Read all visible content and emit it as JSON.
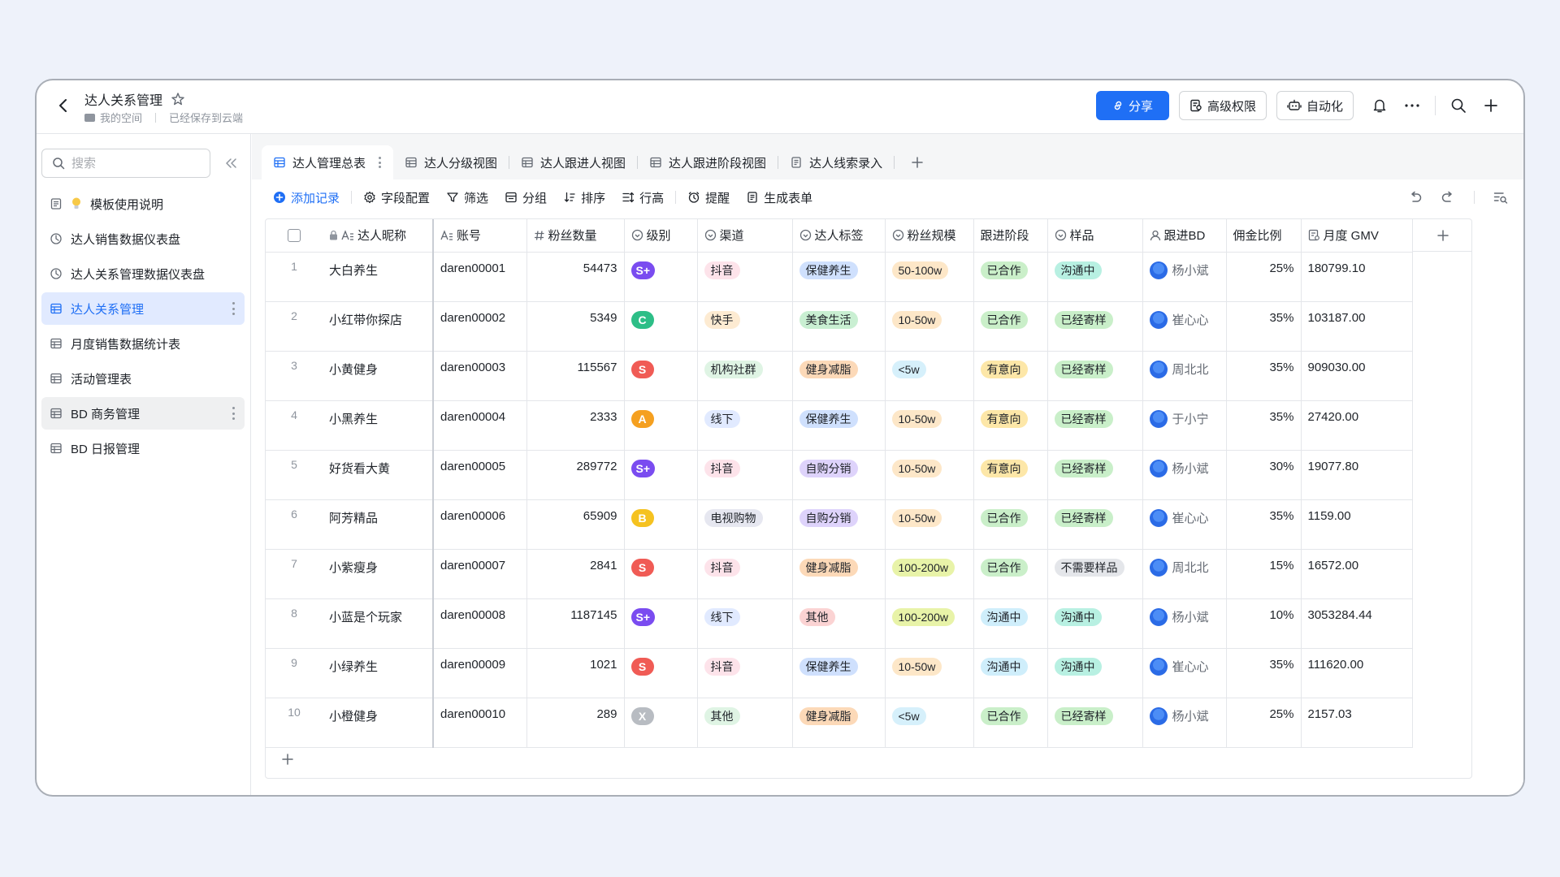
{
  "header": {
    "title": "达人关系管理",
    "crumb_space": "我的空间",
    "crumb_status": "已经保存到云端",
    "share_label": "分享",
    "permission_label": "高级权限",
    "automation_label": "自动化"
  },
  "sidebar": {
    "search_placeholder": "搜索",
    "items": [
      {
        "label": "模板使用说明",
        "icon": "doc-icon"
      },
      {
        "label": "达人销售数据仪表盘",
        "icon": "dashboard-icon"
      },
      {
        "label": "达人关系管理数据仪表盘",
        "icon": "dashboard-icon"
      },
      {
        "label": "达人关系管理",
        "icon": "table-icon"
      },
      {
        "label": "月度销售数据统计表",
        "icon": "table-icon"
      },
      {
        "label": "活动管理表",
        "icon": "table-icon"
      },
      {
        "label": "BD 商务管理",
        "icon": "table-icon"
      },
      {
        "label": "BD 日报管理",
        "icon": "table-icon"
      }
    ]
  },
  "tabs": [
    {
      "label": "达人管理总表",
      "icon": "grid-view-icon"
    },
    {
      "label": "达人分级视图",
      "icon": "grid-view-icon"
    },
    {
      "label": "达人跟进人视图",
      "icon": "grid-view-icon"
    },
    {
      "label": "达人跟进阶段视图",
      "icon": "grid-view-icon"
    },
    {
      "label": "达人线索录入",
      "icon": "form-view-icon"
    }
  ],
  "toolbar": {
    "add_record": "添加记录",
    "field_config": "字段配置",
    "filter": "筛选",
    "group": "分组",
    "sort": "排序",
    "row_height": "行高",
    "reminder": "提醒",
    "form": "生成表单"
  },
  "columns": [
    "达人昵称",
    "账号",
    "粉丝数量",
    "级别",
    "渠道",
    "达人标签",
    "粉丝规模",
    "跟进阶段",
    "样品",
    "跟进BD",
    "佣金比例",
    "月度 GMV"
  ],
  "rows": [
    {
      "idx": "1",
      "name": "大白养生",
      "account": "daren00001",
      "fans": "54473",
      "level": "S+",
      "channel": "抖音",
      "tag": "保健养生",
      "scale": "50-100w",
      "stage": "已合作",
      "sample": "沟通中",
      "bd": "杨小斌",
      "rate": "25%",
      "gmv": "180799.10"
    },
    {
      "idx": "2",
      "name": "小红带你探店",
      "account": "daren00002",
      "fans": "5349",
      "level": "C",
      "channel": "快手",
      "tag": "美食生活",
      "scale": "10-50w",
      "stage": "已合作",
      "sample": "已经寄样",
      "bd": "崔心心",
      "rate": "35%",
      "gmv": "103187.00"
    },
    {
      "idx": "3",
      "name": "小黄健身",
      "account": "daren00003",
      "fans": "115567",
      "level": "S",
      "channel": "机构社群",
      "tag": "健身减脂",
      "scale": "<5w",
      "stage": "有意向",
      "sample": "已经寄样",
      "bd": "周北北",
      "rate": "35%",
      "gmv": "909030.00"
    },
    {
      "idx": "4",
      "name": "小黑养生",
      "account": "daren00004",
      "fans": "2333",
      "level": "A",
      "channel": "线下",
      "tag": "保健养生",
      "scale": "10-50w",
      "stage": "有意向",
      "sample": "已经寄样",
      "bd": "于小宁",
      "rate": "35%",
      "gmv": "27420.00"
    },
    {
      "idx": "5",
      "name": "好货看大黄",
      "account": "daren00005",
      "fans": "289772",
      "level": "S+",
      "channel": "抖音",
      "tag": "自购分销",
      "scale": "10-50w",
      "stage": "有意向",
      "sample": "已经寄样",
      "bd": "杨小斌",
      "rate": "30%",
      "gmv": "19077.80"
    },
    {
      "idx": "6",
      "name": "阿芳精品",
      "account": "daren00006",
      "fans": "65909",
      "level": "B",
      "channel": "电视购物",
      "tag": "自购分销",
      "scale": "10-50w",
      "stage": "已合作",
      "sample": "已经寄样",
      "bd": "崔心心",
      "rate": "35%",
      "gmv": "1159.00"
    },
    {
      "idx": "7",
      "name": "小紫瘦身",
      "account": "daren00007",
      "fans": "2841",
      "level": "S",
      "channel": "抖音",
      "tag": "健身减脂",
      "scale": "100-200w",
      "stage": "已合作",
      "sample": "不需要样品",
      "bd": "周北北",
      "rate": "15%",
      "gmv": "16572.00"
    },
    {
      "idx": "8",
      "name": "小蓝是个玩家",
      "account": "daren00008",
      "fans": "1187145",
      "level": "S+",
      "channel": "线下",
      "tag": "其他",
      "scale": "100-200w",
      "stage": "沟通中",
      "sample": "沟通中",
      "bd": "杨小斌",
      "rate": "10%",
      "gmv": "3053284.44"
    },
    {
      "idx": "9",
      "name": "小绿养生",
      "account": "daren00009",
      "fans": "1021",
      "level": "S",
      "channel": "抖音",
      "tag": "保健养生",
      "scale": "10-50w",
      "stage": "沟通中",
      "sample": "沟通中",
      "bd": "崔心心",
      "rate": "35%",
      "gmv": "111620.00"
    },
    {
      "idx": "10",
      "name": "小橙健身",
      "account": "daren00010",
      "fans": "289",
      "level": "X",
      "channel": "其他",
      "tag": "健身减脂",
      "scale": "<5w",
      "stage": "已合作",
      "sample": "已经寄样",
      "bd": "杨小斌",
      "rate": "25%",
      "gmv": "2157.03"
    }
  ],
  "colors": {
    "accent": "#1f6ff5",
    "level": {
      "S+": "#7a4cf0",
      "S": "#f05b55",
      "A": "#f5a020",
      "B": "#f5c220",
      "C": "#2dbe87",
      "X": "#b8bcc2"
    },
    "channel": {
      "抖音": "#fde3ea",
      "快手": "#fdebd2",
      "机构社群": "#dff4e4",
      "线下": "#e1eaff",
      "电视购物": "#e6e7f0",
      "其他": "#dff4e4"
    },
    "tag": {
      "保健养生": "#cfe0fd",
      "美食生活": "#c9efd2",
      "健身减脂": "#fcd9b8",
      "自购分销": "#ded3fb",
      "其他": "#fbd3d3"
    },
    "scale": {
      "50-100w": "#fde7c8",
      "10-50w": "#fde7c8",
      "<5w": "#d6f0fb",
      "100-200w": "#e8f3a8"
    },
    "stage": {
      "已合作": "#caefc9",
      "有意向": "#fde7a8",
      "沟通中": "#cfeefb"
    },
    "sample": {
      "沟通中": "#b8f0e2",
      "已经寄样": "#c9efc9",
      "不需要样品": "#e4e6ea"
    }
  }
}
